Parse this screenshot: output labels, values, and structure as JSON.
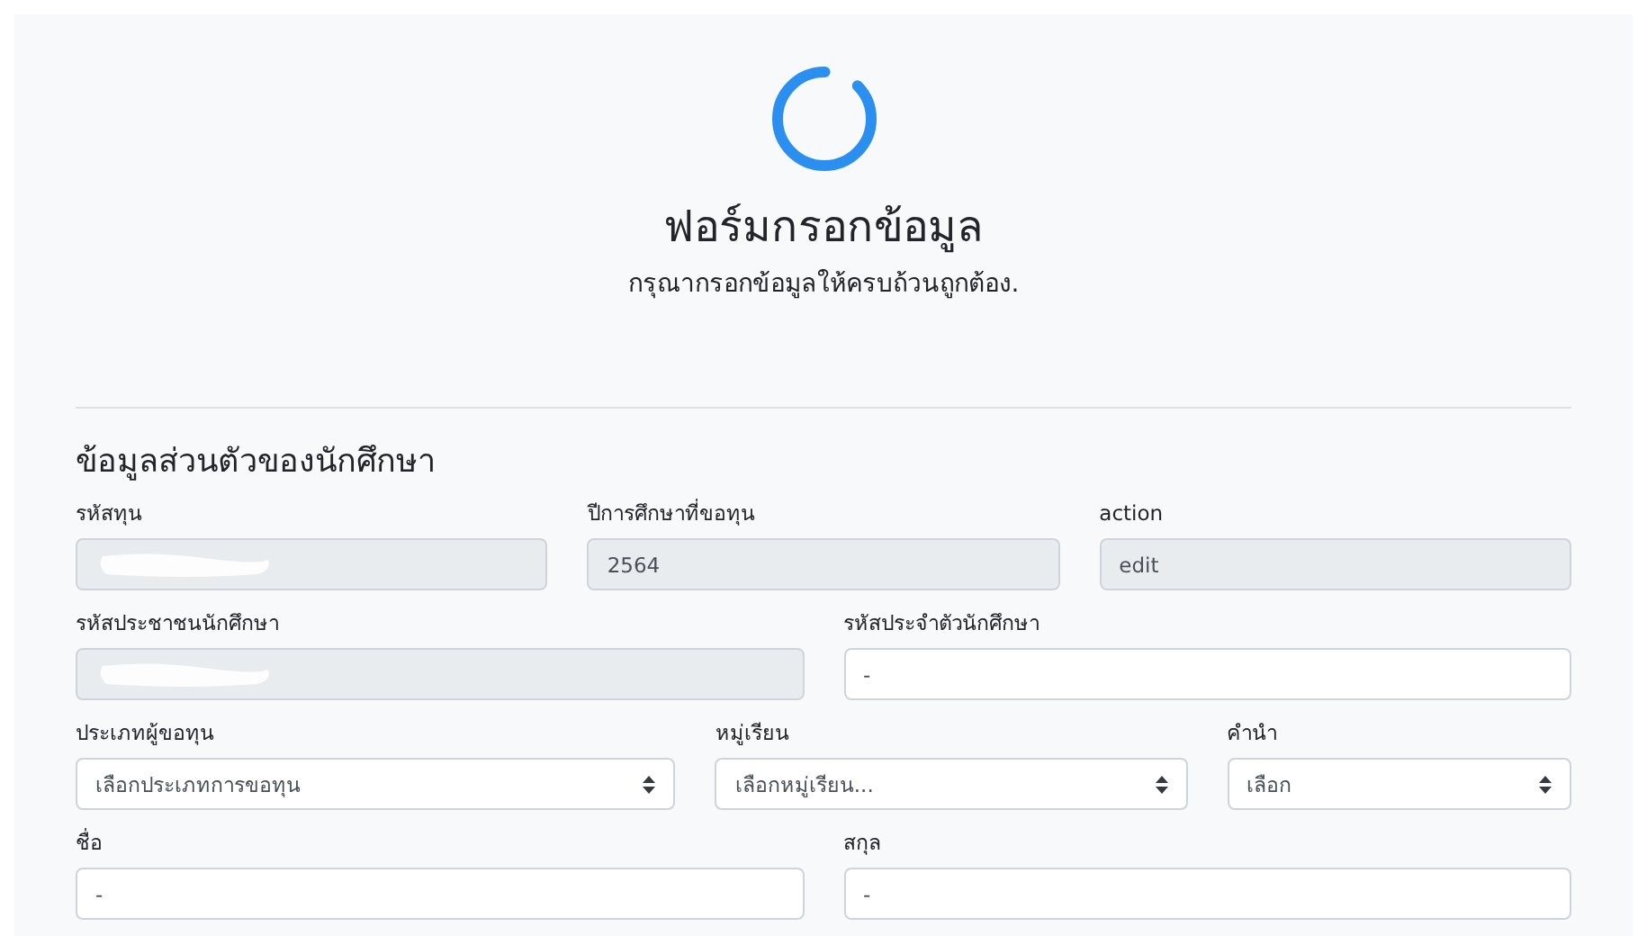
{
  "header": {
    "title": "ฟอร์มกรอกข้อมูล",
    "subtitle": "กรุณากรอกข้อมูลให้ครบถ้วนถูกต้อง."
  },
  "section": {
    "heading": "ข้อมูลส่วนตัวของนักศึกษา",
    "rows": [
      [
        {
          "label": "รหัสทุน",
          "kind": "input",
          "readonly": true,
          "redacted": true
        },
        {
          "label": "ปีการศึกษาที่ขอทุน",
          "kind": "input",
          "readonly": true,
          "value": "2564"
        },
        {
          "label": "action",
          "kind": "input",
          "readonly": true,
          "value": "edit"
        }
      ],
      [
        {
          "label": "รหัสประชาชนนักศึกษา",
          "kind": "input",
          "readonly": true,
          "redacted": true
        },
        {
          "label": "รหัสประจำตัวนักศึกษา",
          "kind": "input",
          "readonly": false,
          "value": "-"
        }
      ],
      [
        {
          "label": "ประเภทผู้ขอทุน",
          "kind": "select",
          "value": "เลือกประเภทการขอทุน"
        },
        {
          "label": "หมู่เรียน",
          "kind": "select",
          "value": "เลือกหมู่เรียน..."
        },
        {
          "label": "คำนำ",
          "kind": "select",
          "value": "เลือก"
        }
      ],
      [
        {
          "label": "ชื่อ",
          "kind": "input",
          "readonly": false,
          "value": "-"
        },
        {
          "label": "สกุล",
          "kind": "input",
          "readonly": false,
          "value": "-"
        }
      ]
    ]
  }
}
